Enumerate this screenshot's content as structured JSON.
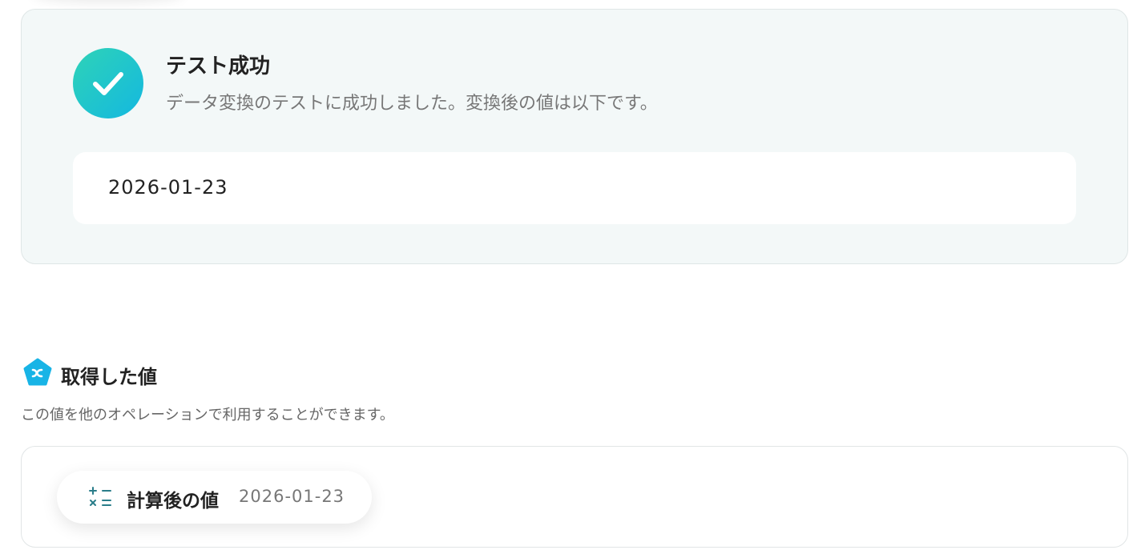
{
  "success": {
    "icon": "check-circle-icon",
    "title": "テスト成功",
    "description": "データ変換のテストに成功しました。変換後の値は以下です。",
    "result_value": "2026-01-23"
  },
  "section": {
    "icon": "function-badge-icon",
    "title": "取得した値",
    "description": "この値を他のオペレーションで利用することができます。"
  },
  "values": [
    {
      "icon": "calculator-icon",
      "label": "計算後の値",
      "value": "2026-01-23"
    }
  ],
  "colors": {
    "success_gradient_start": "#2ed3b7",
    "success_gradient_end": "#14b8e0",
    "panel_background": "#f3f8f8",
    "badge_blue": "#18b4e6",
    "calc_icon": "#2a7d8a"
  }
}
